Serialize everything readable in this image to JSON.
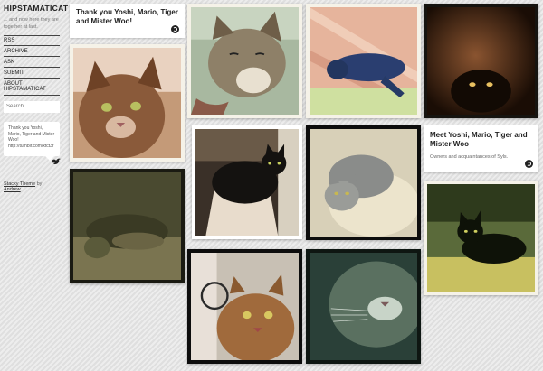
{
  "blog": {
    "title": "HIPSTAMATICAT",
    "description": "... and now here they are together at last."
  },
  "nav": [
    {
      "label": "RSS"
    },
    {
      "label": "ARCHIVE"
    },
    {
      "label": "ASK"
    },
    {
      "label": "SUBMIT"
    },
    {
      "label": "ABOUT HIPSTAMATICAT"
    }
  ],
  "search": {
    "placeholder": "Search"
  },
  "tweet": {
    "text": "Thank you Yoshi, Mario, Tiger and Mister Woo! http://tumblr.com/xtct3r"
  },
  "credit": {
    "theme_link": "Stacky Theme",
    "by": "by",
    "author_link": "Andrew"
  },
  "posts": {
    "text1": {
      "title": "Thank you Yoshi, Mario, Tiger and Mister Woo!"
    },
    "text2": {
      "title": "Meet Yoshi, Mario, Tiger and Mister Woo",
      "body": "Owners and acquaintances of Syls."
    }
  },
  "colors": {
    "background": "#e4e4e4",
    "text": "#222222",
    "link": "#333333"
  }
}
